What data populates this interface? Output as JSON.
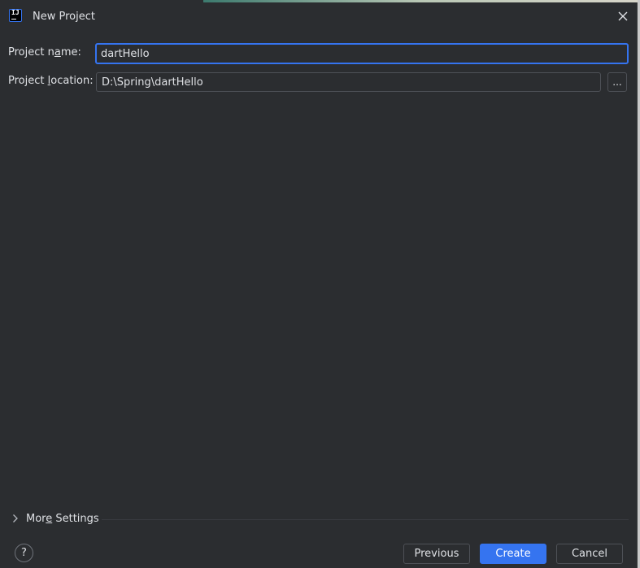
{
  "window": {
    "title": "New Project",
    "icon": "intellij-app-icon",
    "icon_glyph": "IJ",
    "close_icon": "close-icon"
  },
  "form": {
    "project_name": {
      "label_before": "Project n",
      "label_mnemonic": "a",
      "label_after": "me:",
      "value": "dartHello"
    },
    "project_location": {
      "label_before": "Project ",
      "label_mnemonic": "l",
      "label_after": "ocation:",
      "value": "D:\\Spring\\dartHello",
      "browse_label": "..."
    }
  },
  "more_settings": {
    "label_before": "Mor",
    "label_mnemonic": "e",
    "label_after": " Settings",
    "icon": "chevron-right-icon"
  },
  "footer": {
    "help_label": "?",
    "previous_label": "Previous",
    "create_label": "Create",
    "cancel_label": "Cancel"
  },
  "colors": {
    "background": "#2b2d30",
    "accent": "#3574f0",
    "text": "#dfe1e5",
    "border": "#4e5157"
  }
}
